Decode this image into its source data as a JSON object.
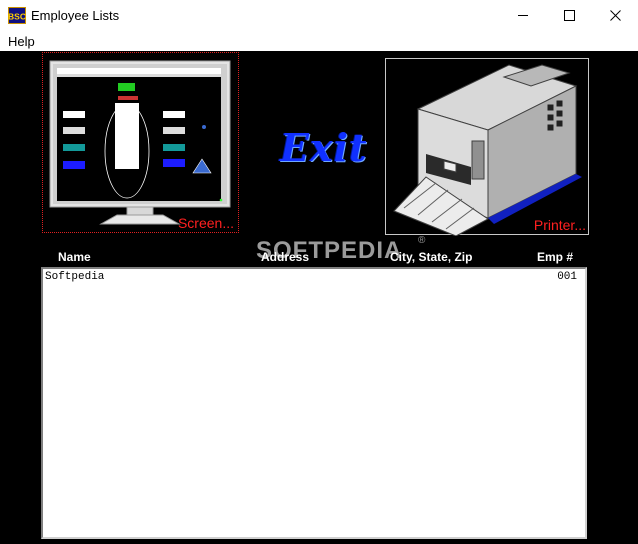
{
  "window": {
    "title": "Employee Lists",
    "icon_name": "bsc-app-icon",
    "icon_text": "BSC",
    "controls": [
      "minimize-icon",
      "maximize-icon",
      "close-icon"
    ]
  },
  "menu": {
    "items": [
      {
        "label": "Help"
      }
    ]
  },
  "panels": {
    "screen_label": "Screen...",
    "exit_label": "Exit",
    "printer_label": "Printer..."
  },
  "list": {
    "columns": [
      "Name",
      "Address",
      "City, State, Zip",
      "Emp #"
    ],
    "rows": [
      {
        "name": "Softpedia",
        "address": "",
        "city_state_zip": "",
        "emp_no": "001"
      }
    ]
  },
  "watermark": {
    "text": "SOFTPEDIA",
    "mark": "®"
  },
  "colors": {
    "accent_label": "#ff2020",
    "exit_logo": "#1030ff",
    "client_bg": "#000000"
  }
}
